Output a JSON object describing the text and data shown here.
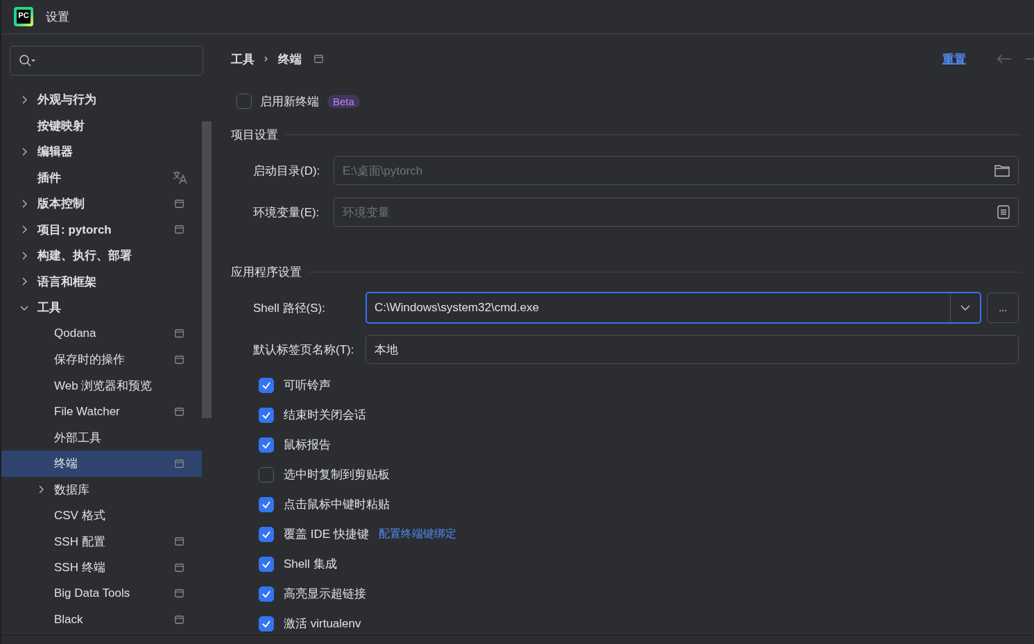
{
  "window": {
    "title": "设置",
    "logo": "PC"
  },
  "sidebar": {
    "items": [
      {
        "label": "外观与行为",
        "kind": "plain",
        "expanded": false,
        "selected": false
      },
      {
        "label": "按键映射",
        "kind": "plain",
        "selected": false
      },
      {
        "label": "编辑器",
        "kind": "plain",
        "expanded": false,
        "selected": false
      },
      {
        "label": "插件",
        "kind": "translatable",
        "selected": false
      },
      {
        "label": "版本控制",
        "kind": "project",
        "expanded": false,
        "selected": false
      },
      {
        "label": "项目: pytorch",
        "kind": "project",
        "expanded": false,
        "selected": false
      },
      {
        "label": "构建、执行、部署",
        "kind": "plain",
        "expanded": false,
        "selected": false
      },
      {
        "label": "语言和框架",
        "kind": "plain",
        "expanded": false,
        "selected": false
      },
      {
        "label": "工具",
        "kind": "plain",
        "expanded": true,
        "selected": false,
        "children": [
          {
            "label": "Qodana",
            "kind": "project",
            "selected": false
          },
          {
            "label": "保存时的操作",
            "kind": "project",
            "selected": false
          },
          {
            "label": "Web 浏览器和预览",
            "kind": "plain",
            "selected": false
          },
          {
            "label": "File Watcher",
            "kind": "project",
            "selected": false
          },
          {
            "label": "外部工具",
            "kind": "plain",
            "selected": false
          },
          {
            "label": "终端",
            "kind": "project",
            "selected": true
          },
          {
            "label": "数据库",
            "kind": "plain",
            "expanded": false,
            "selected": false
          },
          {
            "label": "CSV 格式",
            "kind": "plain",
            "selected": false
          },
          {
            "label": "SSH 配置",
            "kind": "project",
            "selected": false
          },
          {
            "label": "SSH 终端",
            "kind": "project",
            "selected": false
          },
          {
            "label": "Big Data Tools",
            "kind": "project",
            "selected": false
          },
          {
            "label": "Black",
            "kind": "project",
            "selected": false
          }
        ]
      }
    ]
  },
  "breadcrumb": [
    "工具",
    "终端"
  ],
  "reset_link": "重置",
  "new_terminal": {
    "label": "启用新终端",
    "checked": false,
    "badge": "Beta"
  },
  "project_settings": {
    "title": "项目设置",
    "fields": [
      {
        "label": "启动目录(D):",
        "placeholder": "E:\\桌面\\pytorch",
        "kind": "folder"
      },
      {
        "label": "环境变量(E):",
        "placeholder": "环境变量",
        "kind": "list"
      }
    ]
  },
  "app_settings": {
    "title": "应用程序设置",
    "shell_path": {
      "label": "Shell 路径(S):",
      "value": "C:\\Windows\\system32\\cmd.exe",
      "browse": "..."
    },
    "tab_name": {
      "label": "默认标签页名称(T):",
      "value": "本地"
    },
    "options": [
      {
        "label": "可听铃声",
        "checked": true
      },
      {
        "label": "结束时关闭会话",
        "checked": true
      },
      {
        "label": "鼠标报告",
        "checked": true
      },
      {
        "label": "选中时复制到剪贴板",
        "checked": false
      },
      {
        "label": "点击鼠标中键时粘贴",
        "checked": true
      },
      {
        "label": "覆盖 IDE 快捷键",
        "checked": true,
        "link": "配置终端键绑定"
      },
      {
        "label": "Shell 集成",
        "checked": true
      },
      {
        "label": "高亮显示超链接",
        "checked": true
      },
      {
        "label": "激活 virtualenv",
        "checked": true
      }
    ]
  }
}
